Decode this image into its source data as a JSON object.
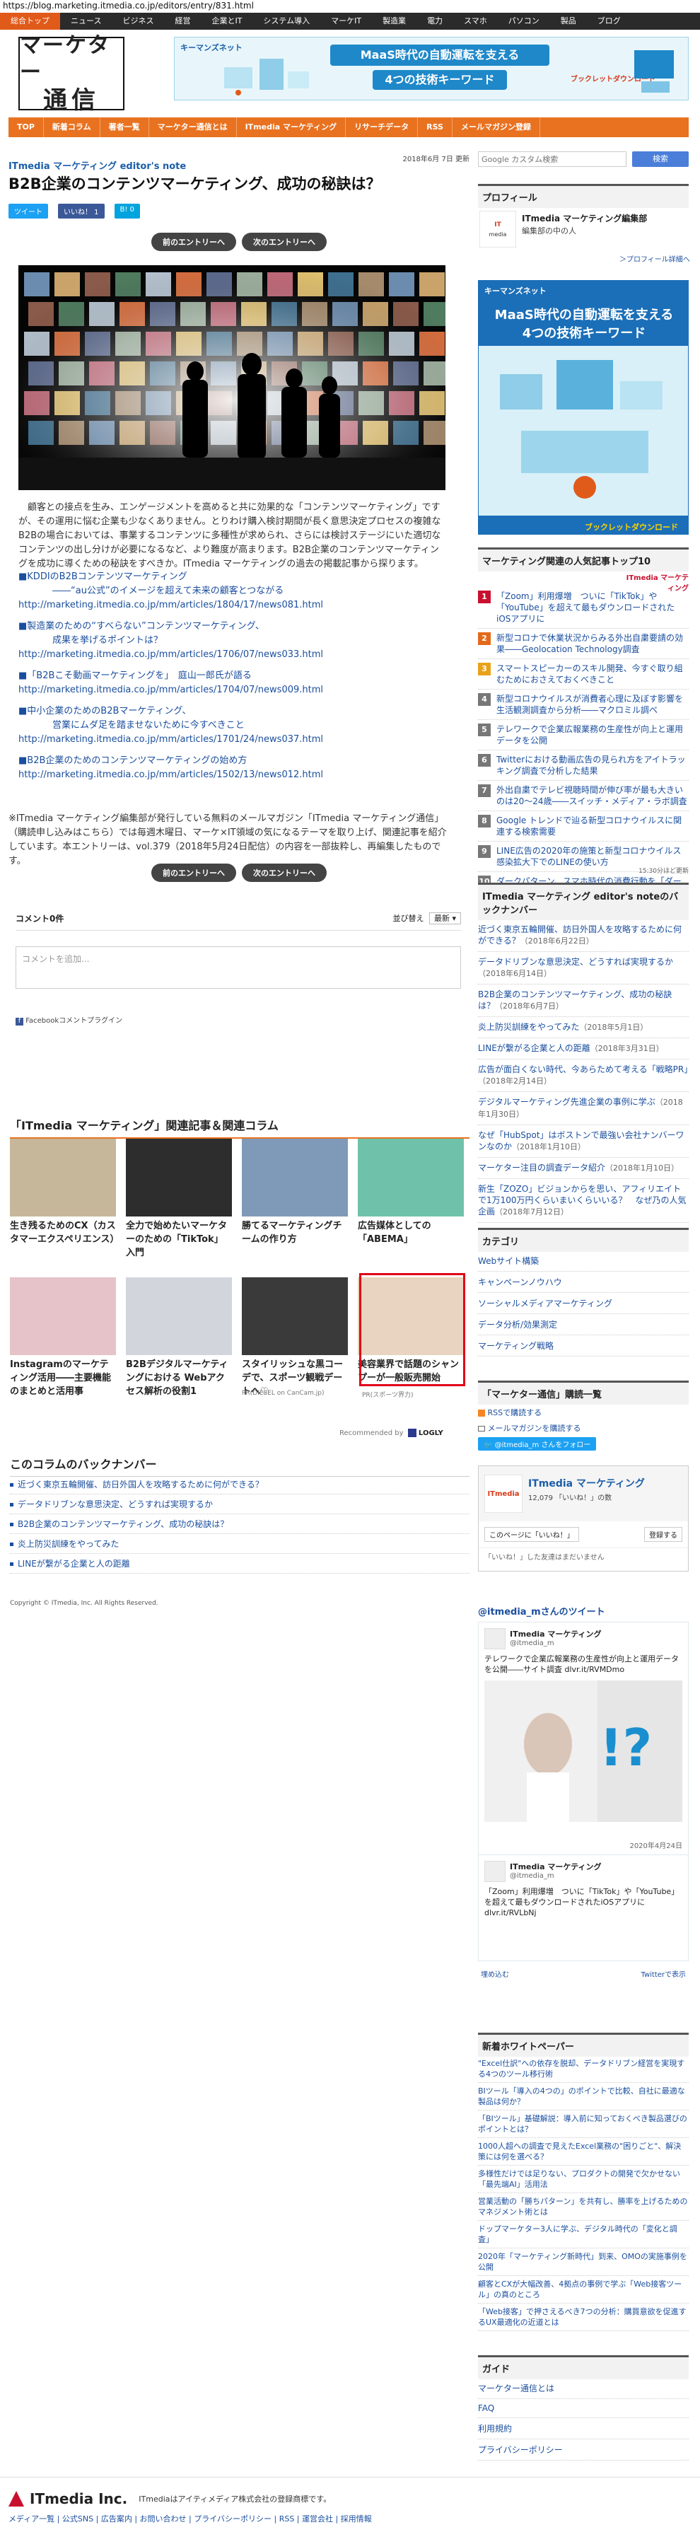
{
  "url": "https://blog.marketing.itmedia.co.jp/editors/entry/831.html",
  "globalnav": [
    "総合トップ",
    "ニュース",
    "ビジネス",
    "経営",
    "企業とIT",
    "システム導入",
    "マーケIT",
    "製造業",
    "電力",
    "スマホ",
    "パソコン",
    "製品",
    "ブログ"
  ],
  "logo": {
    "line1": "マーケター",
    "line2": "通信"
  },
  "header_banner": {
    "brand": "キーマンズネット",
    "headline1": "MaaS時代の自動運転を支える",
    "headline2": "4つの技術キーワード",
    "cta": "ブックレットダウンロード"
  },
  "orangenav": [
    "TOP",
    "新着コラム",
    "著者一覧",
    "マーケター通信とは",
    "ITmedia マーケティング",
    "リサーチデータ",
    "RSS",
    "メールマガジン登録"
  ],
  "post": {
    "blog_name": "ITmedia マーケティング editor's note",
    "date": "2018年6月 7日 更新",
    "title": "B2B企業のコンテンツマーケティング、成功の秘訣は？",
    "share_tweet": "ツイート",
    "share_like": "いいね！ 1",
    "share_hatena": "B! 0",
    "prev": "前のエントリーへ",
    "next": "次のエントリーへ",
    "body": "顧客との接点を生み、エンゲージメントを高めると共に効果的な「コンテンツマーケティング」ですが、その運用に悩む企業も少なくありません。とりわけ購入検討期間が長く意思決定プロセスの複雑なB2Bの場合においては、事業するコンテンツに多種性が求められ、さらには検討ステージにいた適切なコンテンツの出し分けが必要になるなど、より難度が高まります。B2B企業のコンテンツマーケティングを成功に導くための秘訣をすべきか。ITmedia マーケティングの過去の掲載記事から探ります。",
    "links": [
      {
        "title": "■KDDIのB2Bコンテンツマーケティング",
        "sub": "――“au公式”のイメージを超えて未来の顧客とつながる",
        "url": "http://marketing.itmedia.co.jp/mm/articles/1804/17/news081.html"
      },
      {
        "title": "■製造業のための“すべらない”コンテンツマーケティング、",
        "sub": "成果を挙げるポイントは？",
        "url": "http://marketing.itmedia.co.jp/mm/articles/1706/07/news033.html"
      },
      {
        "title": "■「B2Bこそ動画マーケティングを」　庭山一郎氏が語る",
        "sub": "",
        "url": "http://marketing.itmedia.co.jp/mm/articles/1704/07/news009.html"
      },
      {
        "title": "■中小企業のためのB2Bマーケティング、",
        "sub": "営業にムダ足を踏ませないために今すべきこと",
        "url": "http://marketing.itmedia.co.jp/mm/articles/1701/24/news037.html"
      },
      {
        "title": "■B2B企業のためのコンテンツマーケティングの始め方",
        "sub": "",
        "url": "http://marketing.itmedia.co.jp/mm/articles/1502/13/news012.html"
      }
    ],
    "footnote": "※ITmedia マーケティング編集部が発行している無料のメールマガジン「ITmedia マーケティング通信」（購読申し込みはこちら）では毎週木曜日、マーケ×IT領域の気になるテーマを取り上げ、関連記事を紹介しています。本エントリーは、vol.379（2018年5月24日配信）の内容を一部抜粋し、再編集したものです。"
  },
  "comments": {
    "count": "コメント0件",
    "sort_label": "並び替え",
    "sort_value": "最新",
    "placeholder": "コメントを追加...",
    "plugin": "Facebookコメントプラグイン"
  },
  "related": {
    "heading": "「ITmedia マーケティング」関連記事＆関連コラム",
    "cards": [
      {
        "title": "生き残るためのCX（カスタマーエクスペリエンス）"
      },
      {
        "title": "全力で始めたいマーケターのための「TikTok」入門"
      },
      {
        "title": "勝てるマーケティングチームの作り方"
      },
      {
        "title": "広告媒体としての「ABEMA」"
      },
      {
        "title": "Instagramのマーケティング活用――主要機能のまとめと活用事"
      },
      {
        "title": "B2Bデジタルマーケティングにおける Webアクセス解析の役割1"
      },
      {
        "title": "スタイリッシュな黒コーデで、スポーツ観戦デートへ♡"
      },
      {
        "title": "美容業界で話題のシャンプーが一般販売開始"
      }
    ],
    "pr1": "PR(DIESEL on CanCam.jp)",
    "pr2": "PR(スポーツ界力)",
    "recommended": "Recommended by",
    "recommended_brand": "LOGLY"
  },
  "backnumber": {
    "heading": "このコラムのバックナンバー",
    "items": [
      "近づく東京五輪開催、訪日外国人を攻略するために何ができる？",
      "データドリブンな意思決定、どうすれば実現するか",
      "B2B企業のコンテンツマーケティング、成功の秘訣は？",
      "炎上防災訓練をやってみた",
      "LINEが繋がる企業と人の距離"
    ]
  },
  "copyright": "Copyright © ITmedia, Inc. All Rights Reserved.",
  "sidebar": {
    "search_placeholder": "Google カスタム検索",
    "search_button": "検索",
    "profile_head": "プロフィール",
    "profile_name": "ITmedia マーケティング編集部",
    "profile_role": "編集部の中の人",
    "profile_more": "＞プロフィール詳細へ",
    "banner2": {
      "brand": "キーマンズネット",
      "headline1": "MaaS時代の自動運転を支える",
      "headline2": "4つの技術キーワード",
      "cta": "ブックレットダウンロード"
    },
    "ranking_head": "マーケティング関連の人気記事トップ10",
    "ranking_logo": "ITmedia マーケティング",
    "ranking": [
      {
        "no": "1",
        "text": "「Zoom」利用爆増　ついに「TikTok」や「YouTube」を超えて最もダウンロードされたiOSアプリに"
      },
      {
        "no": "2",
        "text": "新型コロナで休業状況からみる外出自粛要請の効果――Geolocation Technology調査"
      },
      {
        "no": "3",
        "text": "スマートスピーカーのスキル開発、今すぐ取り組むためにおさえておくべきこと"
      },
      {
        "no": "4",
        "text": "新型コロナウイルスが消費者心理に及ぼす影響を生活観測調査から分析――マクロミル調べ"
      },
      {
        "no": "5",
        "text": "テレワークで企業広報業務の生産性が向上と運用データを公開"
      },
      {
        "no": "6",
        "text": "Twitterにおける動画広告の見られ方をアイトラッキング調査で分析した結果"
      },
      {
        "no": "7",
        "text": "外出自粛でテレビ視聴時間が伸び率が最も大きいのは20〜24歳――スイッチ・メディア・ラボ調査"
      },
      {
        "no": "8",
        "text": "Google トレンドで辿る新型コロナウイルスに関連する検索需要"
      },
      {
        "no": "9",
        "text": "LINE広告の2020年の施策と新型コロナウイルス感染拡大下でのLINEの使い方"
      },
      {
        "no": "10",
        "text": "ダークパターン、スマホ時代の消費行動を「ダークー型」から「パルス型」へ"
      }
    ],
    "ranking_time": "15:30分ほど更新",
    "ed_bn_head": "ITmedia マーケティング editor's noteのバックナンバー",
    "ed_bn": [
      {
        "t": "近づく東京五輪開催、訪日外国人を攻略するために何ができる？",
        "d": "（2018年6月22日）"
      },
      {
        "t": "データドリブンな意思決定、どうすれば実現するか",
        "d": "（2018年6月14日）"
      },
      {
        "t": "B2B企業のコンテンツマーケティング、成功の秘訣は？",
        "d": "（2018年6月7日）"
      },
      {
        "t": "炎上防災訓練をやってみた",
        "d": "（2018年5月1日）"
      },
      {
        "t": "LINEが繋がる企業と人の距離",
        "d": "（2018年3月31日）"
      },
      {
        "t": "広告が面白くない時代、今あらためて考える「戦略PR」",
        "d": "（2018年2月14日）"
      },
      {
        "t": "デジタルマーケティング先進企業の事例に学ぶ",
        "d": "（2018年1月30日）"
      },
      {
        "t": "なぜ「HubSpot」はボストンで最強い会社ナンバーワンなのか",
        "d": "（2018年1月10日）"
      },
      {
        "t": "マーケター注目の調査データ紹介",
        "d": "（2018年1月10日）"
      },
      {
        "t": "新生「ZOZO」ビジョンからを思い、アフィリエイトで1万100万円くらいまいくらいいる？　なぜ乃の人気企画",
        "d": "（2018年7月12日）"
      }
    ],
    "category_head": "カテゴリ",
    "categories": [
      "Webサイト構築",
      "キャンペーンノウハウ",
      "ソーシャルメディアマーケティング",
      "データ分析/効果測定",
      "マーケティング戦略"
    ],
    "subscribe_head": "「マーケター通信」購読一覧",
    "subscribe": [
      "RSSで購読する",
      "メールマガジンを購読する"
    ],
    "follow_badge": "@itmedia_m さんをフォロー",
    "fb_page_name": "ITmedia マーケティング",
    "fb_likes": "12,079 「いいね！」の数",
    "fb_like_btn": "このページに「いいね！」",
    "fb_signup": "登録する",
    "fb_note": "「いいね！」した友達はまだいません",
    "tw_head": "@itmedia_mさんのツイート",
    "tweets": [
      {
        "name": "ITmedia マーケティング",
        "handle": "@itmedia_m",
        "text": "テレワークで企業広報業務の生産性が向上と運用データを公開――サイト調査 dlvr.it/RVMDmo",
        "date": "2020年4月24日"
      },
      {
        "name": "ITmedia マーケティング",
        "handle": "@itmedia_m",
        "text": "「Zoom」利用爆増　ついに「TikTok」や「YouTube」を超えて最もダウンロードされたiOSアプリに dlvr.it/RVLbNj",
        "date": ""
      }
    ],
    "tw_embed": "埋め込む",
    "tw_view": "Twitterで表示",
    "wp_head": "新着ホワイトペーパー",
    "whitepapers": [
      "\"Excel仕訳\"への依存を脱却、データドリブン経営を実現する4つのツール移行術",
      "BIツール「導入の4つの」のポイントで比較、自社に最適な製品は何か？",
      "「BIツール」基礎解説：導入前に知っておくべき製品選びのポイントとは？",
      "1000人超への調査で見えたExcel業務の\"困りごと\"、解決策には何を選べる？",
      "多様性だけでは足りない、プロダクトの開発で欠かせない「最先端AI」活用法",
      "営業活動の「勝ちパターン」を共有し、勝率を上げるためのマネジメント術とは",
      "ドップマーケター3人に学ぶ、デジタル時代の「変化と調査」",
      "2020年「マーケティング新時代」到来、OMOの実施事例を公開",
      "顧客とCXが大幅改善、4拠点の事例で学ぶ「Web接客ツール」の真のところ",
      "「Web接客」で押さえるべき7つの分析：購買意欲を促進するUX最適化の近道とは"
    ],
    "guide_head": "ガイド",
    "guide": [
      "マーケター通信とは",
      "FAQ",
      "利用規約",
      "プライバシーポリシー"
    ]
  },
  "footer": {
    "brand": "ITmedia Inc.",
    "trademark": "ITmediaはアイティメディア株式会社の登録商標です。",
    "links": "メディア一覧 | 公式SNS | 広告案内 | お問い合わせ | プライバシーポリシー | RSS | 運営会社 | 採用情報"
  }
}
